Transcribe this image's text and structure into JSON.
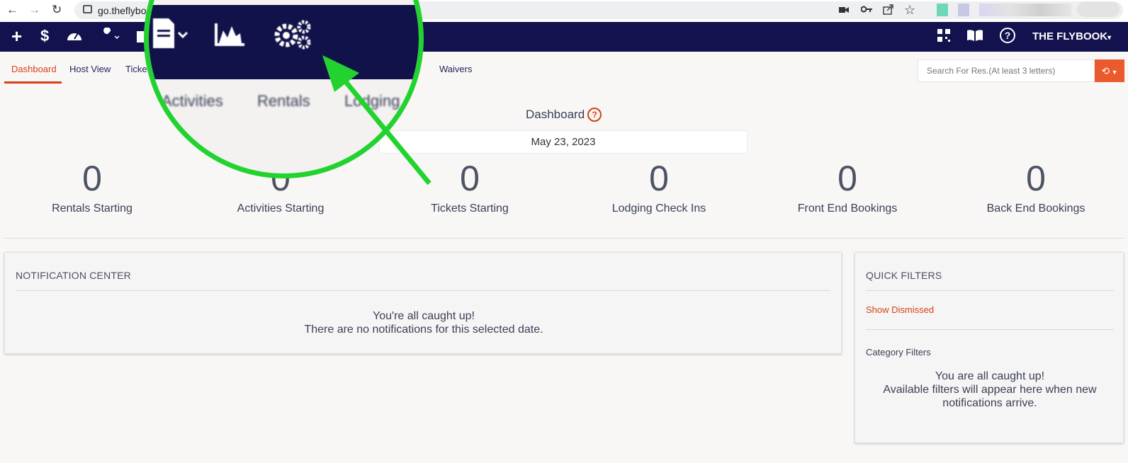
{
  "browser": {
    "url": "go.theflybo",
    "icons": [
      "back-arrow-icon",
      "forward-arrow-icon",
      "reload-icon",
      "camera-icon",
      "key-icon",
      "share-icon",
      "star-icon"
    ]
  },
  "navbar": {
    "brand": "THE FLYBOOK",
    "icons": [
      "plus-icon",
      "dollar-icon",
      "dashboard-gauge-icon",
      "wrench-icon",
      "calendar-icon",
      "qr-code-icon",
      "book-icon",
      "help-icon"
    ]
  },
  "tabs": [
    {
      "label": "Dashboard",
      "active": true
    },
    {
      "label": "Host View"
    },
    {
      "label": "Ticke"
    },
    {
      "label": "Waivers"
    }
  ],
  "search": {
    "placeholder": "Search For Res.(At least 3 letters)"
  },
  "dashboard": {
    "title": "Dashboard",
    "help": "?",
    "date": "May 23, 2023"
  },
  "stats": [
    {
      "value": "0",
      "label": "Rentals Starting"
    },
    {
      "value": "0",
      "label": "Activities Starting"
    },
    {
      "value": "0",
      "label": "Tickets Starting"
    },
    {
      "value": "0",
      "label": "Lodging Check Ins"
    },
    {
      "value": "0",
      "label": "Front End Bookings"
    },
    {
      "value": "0",
      "label": "Back End Bookings"
    }
  ],
  "notifications": {
    "title": "NOTIFICATION CENTER",
    "line1": "You're all caught up!",
    "line2": "There are no notifications for this selected date."
  },
  "quick_filters": {
    "title": "QUICK FILTERS",
    "show_dismissed": "Show Dismissed",
    "category_filters": "Category Filters",
    "line1": "You are all caught up!",
    "line2": "Available filters will appear here when new",
    "line3": "notifications arrive."
  },
  "zoom_callout": {
    "tabs": [
      "Activities",
      "Rentals",
      "Lodging"
    ],
    "icons": [
      "document-icon",
      "chart-icon",
      "settings-gears-icon"
    ],
    "highlight_color": "#22d330"
  },
  "colors": {
    "nav": "#13124f",
    "accent": "#d64118",
    "search_button": "#ea5a2c"
  }
}
